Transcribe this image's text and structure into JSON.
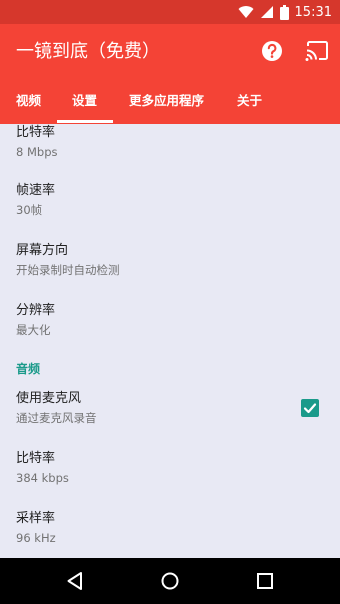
{
  "status_bar": {
    "time": "15:31"
  },
  "app_bar": {
    "title": "一镜到底（免费）"
  },
  "tabs": [
    {
      "label": "视频",
      "selected": false
    },
    {
      "label": "设置",
      "selected": true
    },
    {
      "label": "更多应用程序",
      "selected": false
    },
    {
      "label": "关于",
      "selected": false
    }
  ],
  "video_prefs": [
    {
      "title": "比特率",
      "summary": "8 Mbps"
    },
    {
      "title": "帧速率",
      "summary": "30帧"
    },
    {
      "title": "屏幕方向",
      "summary": "开始录制时自动检测"
    },
    {
      "title": "分辨率",
      "summary": "最大化"
    }
  ],
  "audio_category": "音频",
  "microphone_pref": {
    "title": "使用麦克风",
    "summary": "通过麦克风录音",
    "checked": true
  },
  "audio_prefs": [
    {
      "title": "比特率",
      "summary": "384 kbps"
    },
    {
      "title": "采样率",
      "summary": "96 kHz"
    }
  ],
  "colors": {
    "app_bar": "#f44336",
    "status_bar": "#d6372c",
    "accent": "#1a9a8a",
    "background": "#e8e9f4"
  }
}
